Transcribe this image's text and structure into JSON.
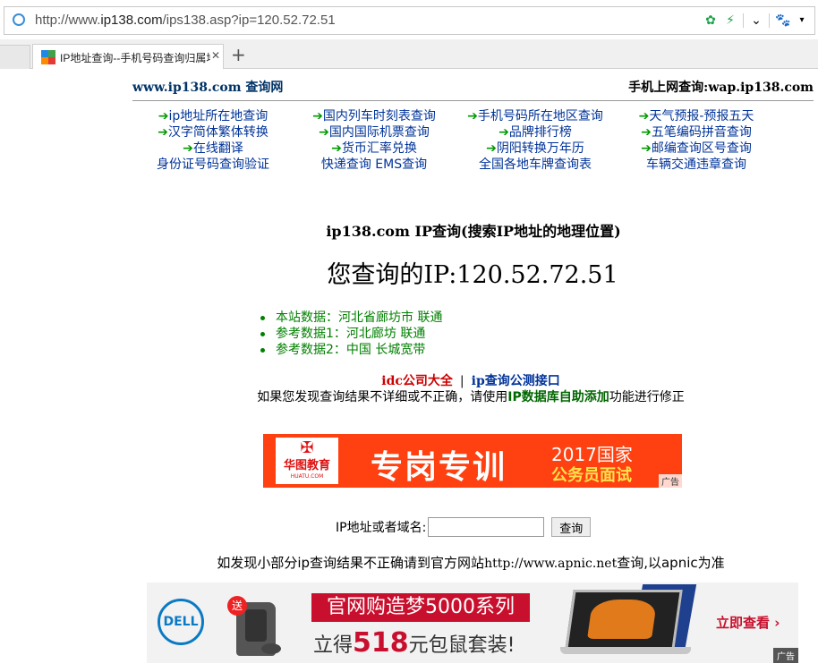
{
  "browser": {
    "url_prefix": "http://www.",
    "url_host": "ip138.com",
    "url_path": "/ips138.asp?ip=120.52.72.51",
    "tab_title": "IP地址查询--手机号码查询归属地",
    "tab_close": "✕",
    "new_tab": "+"
  },
  "site": {
    "title": "www.ip138.com 查询网",
    "wap": "手机上网查询:wap.ip138.com"
  },
  "nav_rows": [
    [
      {
        "arrow": "➔",
        "label": "ip地址所在地查询"
      },
      {
        "arrow": "➔",
        "label": "国内列车时刻表查询"
      },
      {
        "arrow": "➔",
        "label": "手机号码所在地区查询"
      },
      {
        "arrow": "➔",
        "label": "天气预报-预报五天"
      }
    ],
    [
      {
        "arrow": "➔",
        "label": "汉字简体繁体转换"
      },
      {
        "arrow": "➔",
        "label": "国内国际机票查询"
      },
      {
        "arrow": "➔",
        "label": "品牌排行榜"
      },
      {
        "arrow": "➔",
        "label": "五笔编码拼音查询"
      }
    ],
    [
      {
        "arrow": "➔",
        "label": "在线翻译"
      },
      {
        "arrow": "➔",
        "label": "货币汇率兑换"
      },
      {
        "arrow": "➔",
        "label": "阴阳转换万年历"
      },
      {
        "arrow": "➔",
        "label": "邮编查询区号查询"
      }
    ],
    [
      {
        "arrow": "",
        "label": "身份证号码查询验证"
      },
      {
        "arrow": "",
        "label": "快递查询 EMS查询"
      },
      {
        "arrow": "",
        "label": "全国各地车牌查询表"
      },
      {
        "arrow": "",
        "label": "车辆交通违章查询"
      }
    ]
  ],
  "main": {
    "heading": "ip138.com IP查询(搜索IP地址的地理位置)",
    "ip_line": "您查询的IP:120.52.72.51",
    "results": [
      "本站数据：河北省廊坊市 联通",
      "参考数据1：河北廊坊 联通",
      "参考数据2：中国 长城宽带"
    ],
    "link_idc": "idc公司大全",
    "link_sep": "|",
    "link_api": "ip查询公测接口",
    "notice_before": "如果您发现查询结果不详细或不正确，请使用",
    "notice_link": "IP数据库自助添加",
    "notice_after": "功能进行修正"
  },
  "ad1": {
    "logo_text": "华图教育",
    "logo_sub": "HUATU.COM",
    "main": "专岗专训",
    "right1": "2017国家",
    "right2": "公务员面试",
    "tag": "广告"
  },
  "search": {
    "label": "IP地址或者域名:",
    "value": "",
    "button": "查询"
  },
  "apnic": {
    "before": "如发现小部分ip查询结果不正确请到官方网站",
    "url": "http://www.apnic.net",
    "after": "查询,以apnic为准"
  },
  "ad2": {
    "brand": "DELL",
    "gift": "送",
    "banner": "官网购造梦5000系列",
    "promo_before": "立得",
    "promo_num": "518",
    "promo_after": "元包鼠套装!",
    "cta": "立即查看 ›",
    "tag": "广告"
  },
  "colors": {
    "link": "#003399",
    "arrow": "#009900",
    "result": "#008000",
    "red": "#cc0000",
    "ad_orange": "#ff4010",
    "dell_blue": "#0a7ac4"
  }
}
